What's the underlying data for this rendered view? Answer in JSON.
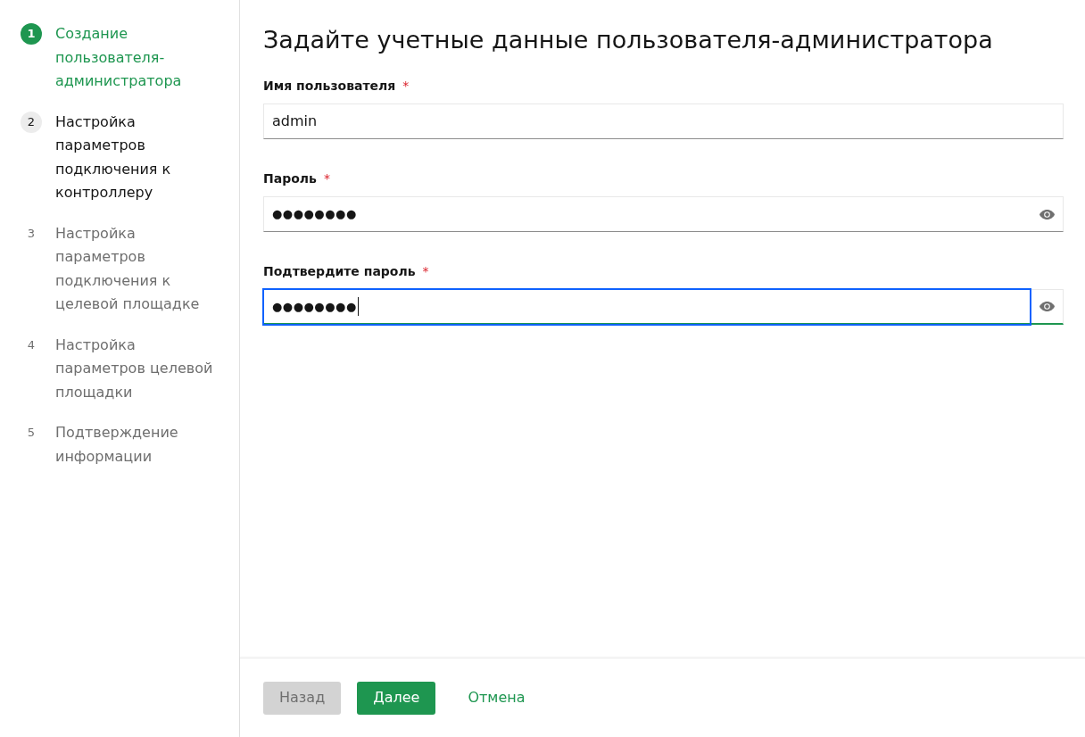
{
  "steps": [
    {
      "number": "1",
      "label": "Создание пользователя-администратора",
      "selected": true,
      "disabled": false
    },
    {
      "number": "2",
      "label": "Настройка параметров подключения к контроллеру",
      "selected": false,
      "disabled": false
    },
    {
      "number": "3",
      "label": "Настройка параметров подключения к целевой площадке",
      "selected": false,
      "disabled": true
    },
    {
      "number": "4",
      "label": "Настройка параметров целевой площадки",
      "selected": false,
      "disabled": true
    },
    {
      "number": "5",
      "label": "Подтверждение информации",
      "selected": false,
      "disabled": true
    }
  ],
  "form": {
    "title": "Задайте учетные данные пользователя-администратора",
    "fields": [
      {
        "kind": "text",
        "label": "Имя пользователя",
        "required_mark": "*",
        "value": "admin",
        "focused": false,
        "valid": false
      },
      {
        "kind": "password",
        "label": "Пароль",
        "required_mark": "*",
        "value": "●●●●●●●●",
        "focused": false,
        "valid": false
      },
      {
        "kind": "password",
        "label": "Подтвердите пароль",
        "required_mark": "*",
        "value": "●●●●●●●●",
        "focused": true,
        "valid": true
      }
    ]
  },
  "footer": {
    "buttons": [
      {
        "kind": "secondary",
        "label": "Назад",
        "disabled": true
      },
      {
        "kind": "primary",
        "label": "Далее",
        "disabled": false
      },
      {
        "kind": "ghost",
        "label": "Отмена",
        "disabled": false
      }
    ]
  }
}
